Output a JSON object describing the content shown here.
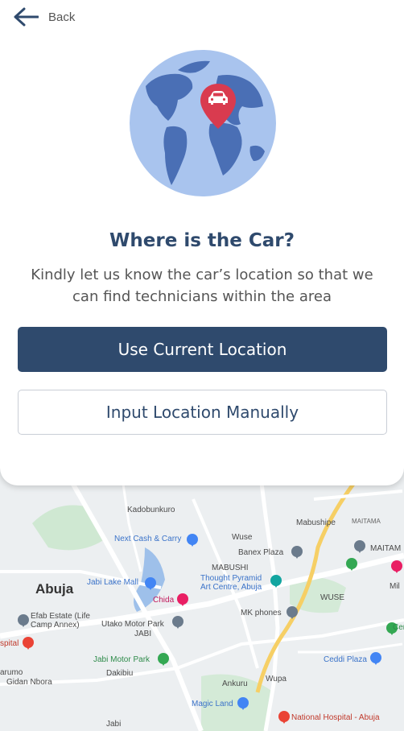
{
  "header": {
    "back_label": "Back"
  },
  "main": {
    "title": "Where is the Car?",
    "subtitle": "Kindly let us know the car’s location so that we can find technicians within the area",
    "primary_button": "Use Current Location",
    "secondary_button": "Input Location Manually"
  },
  "colors": {
    "primary": "#2f4a6d",
    "globe_ocean": "#a9c4ee",
    "globe_land": "#4a6fb5",
    "pin": "#d93b4f"
  },
  "map": {
    "labels": {
      "kadobunkuro": "Kadobunkuro",
      "mabushipe": "Mabushipe",
      "maitama": "MAITAMA",
      "maitama2": "MAITAM",
      "next_cash": "Next Cash & Carry",
      "wuse": "Wuse",
      "banex": "Banex Plaza",
      "mabushi": "MABUSHI",
      "abuja": "Abuja",
      "jabi_lake": "Jabi Lake Mall",
      "thought_pyramid": "Thought Pyramid Art Centre, Abuja",
      "chida": "Chida",
      "wuse_caps": "WUSE",
      "efab": "Efab Estate (Life Camp Annex)",
      "utako": "Utako Motor Park",
      "jabi_caps": "JABI",
      "mk_phones": "MK phones",
      "hospital_left": "spital",
      "jabi_motor": "Jabi Motor Park",
      "dakibiu": "Dakibiu",
      "ceddi": "Ceddi Plaza",
      "arumo": "arumo",
      "gidan": "Gidan Nbora",
      "ankuru": "Ankuru",
      "wupa": "Wupa",
      "magic_land": "Magic Land",
      "national_hospital": "National Hospital - Abuja",
      "jabi_bottom": "Jabi",
      "mil": "Mil",
      "cen": "Cen"
    }
  }
}
